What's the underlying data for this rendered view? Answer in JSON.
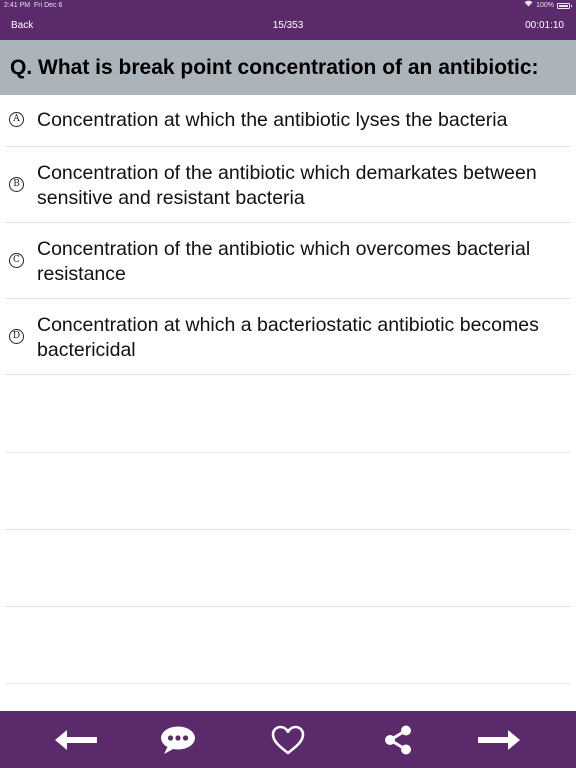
{
  "status_bar": {
    "time": "2:41 PM",
    "date": "Fri Dec 6",
    "battery": "100%"
  },
  "nav": {
    "back_label": "Back",
    "counter": "15/353",
    "timer": "00:01:10"
  },
  "question": {
    "prefix": "Q.",
    "text": "What is break point concentration of an antibiotic:"
  },
  "options": [
    {
      "letter": "A",
      "text": "Concentration at which the antibiotic lyses the bacteria"
    },
    {
      "letter": "B",
      "text": "Concentration of the antibiotic which demarkates between sensitive and resistant bacteria"
    },
    {
      "letter": "C",
      "text": "Concentration of the antibiotic which overcomes bacterial resistance"
    },
    {
      "letter": "D",
      "text": "Concentration at which a bacteriostatic antibiotic becomes bactericidal"
    }
  ],
  "toolbar": {
    "icons": [
      "arrow-left-icon",
      "chat-bubble-icon",
      "heart-icon",
      "share-icon",
      "arrow-right-icon"
    ]
  },
  "colors": {
    "header_purple": "#5a2a6b",
    "question_bg": "#aab4ba"
  }
}
